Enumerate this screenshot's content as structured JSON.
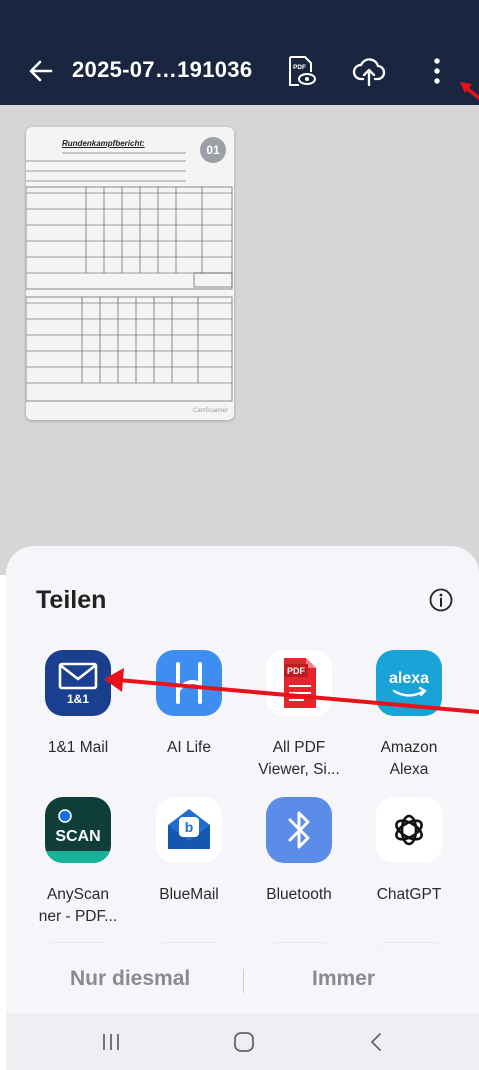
{
  "header": {
    "back_icon": "arrow-left-icon",
    "title": "2025-07…191036",
    "pdf_preview_icon": "pdf-eye-icon",
    "upload_icon": "cloud-upload-icon",
    "more_icon": "more-vert-icon"
  },
  "document": {
    "page_badge": "01",
    "heading_text": "Rundenkampfbericht:",
    "watermark_text": "CamScanner"
  },
  "share_sheet": {
    "title": "Teilen",
    "info_icon": "info-icon",
    "apps": [
      {
        "label": "1&1 Mail",
        "icon": "1und1-mail-icon"
      },
      {
        "label": "AI Life",
        "icon": "ai-life-icon"
      },
      {
        "label": "All PDF Viewer, Si...",
        "icon": "all-pdf-icon"
      },
      {
        "label": "Amazon Alexa",
        "icon": "alexa-icon"
      },
      {
        "label": "AnyScan ner - PDF...",
        "icon": "anyscan-icon"
      },
      {
        "label": "BlueMail",
        "icon": "bluemail-icon"
      },
      {
        "label": "Bluetooth",
        "icon": "bluetooth-icon"
      },
      {
        "label": "ChatGPT",
        "icon": "chatgpt-icon"
      }
    ],
    "icon_texts": {
      "mail_brand": "1&1",
      "pdf_badge": "PDF",
      "alexa": "alexa",
      "scan": "SCAN",
      "pdf_eye": "PDF"
    },
    "actions": {
      "once": "Nur diesmal",
      "always": "Immer"
    }
  },
  "navbar": {
    "recents_icon": "recents-icon",
    "home_icon": "home-icon",
    "back_icon": "nav-back-icon"
  },
  "colors": {
    "header_bg": "#1a2640",
    "sheet_bg": "#f6f5fa",
    "annotation_red": "#e8121a"
  }
}
